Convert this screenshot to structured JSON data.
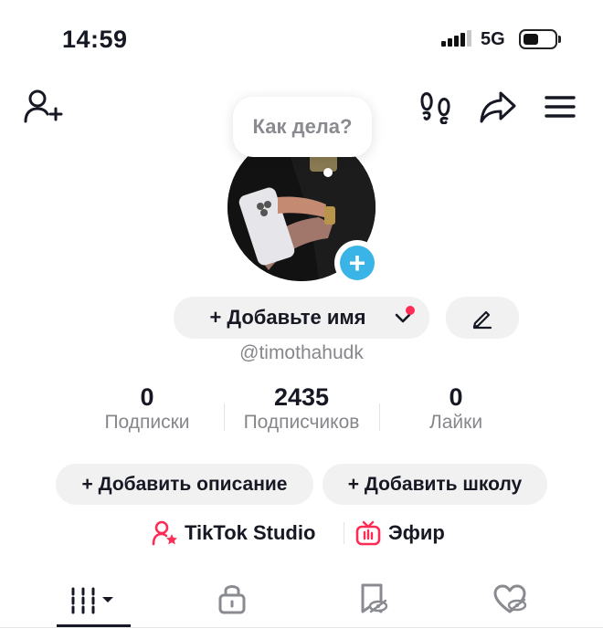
{
  "status_bar": {
    "time": "14:59",
    "network": "5G"
  },
  "bubble": {
    "text": "Как дела?"
  },
  "profile": {
    "add_name_label": "+ Добавьте имя",
    "username": "@timothahudk"
  },
  "stats": [
    {
      "value": "0",
      "label": "Подписки"
    },
    {
      "value": "2435",
      "label": "Подписчиков"
    },
    {
      "value": "0",
      "label": "Лайки"
    }
  ],
  "actions": {
    "add_description": "+ Добавить описание",
    "add_school": "+ Добавить школу"
  },
  "links": {
    "studio": "TikTok Studio",
    "live": "Эфир"
  },
  "colors": {
    "accent": "#fe2c55",
    "avatar_plus": "#3ab4e6",
    "muted_text": "#86878b",
    "pill_bg": "#f1f1f2"
  },
  "icons": [
    "add-friend-icon",
    "footprints-icon",
    "share-icon",
    "menu-icon",
    "edit-icon",
    "grid-icon",
    "lock-icon",
    "bookmark-icon",
    "liked-icon"
  ]
}
